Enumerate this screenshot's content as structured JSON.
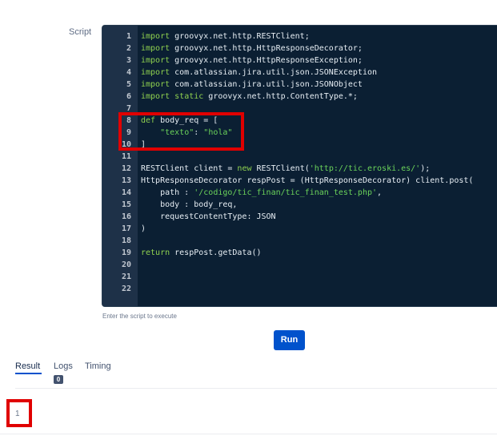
{
  "script": {
    "label": "Script",
    "hint": "Enter the script to execute",
    "lines": [
      {
        "n": "1",
        "segs": [
          {
            "t": "import",
            "k": "kw"
          },
          {
            "t": " groovyx.net.http.RESTClient;"
          }
        ]
      },
      {
        "n": "2",
        "segs": [
          {
            "t": "import",
            "k": "kw"
          },
          {
            "t": " groovyx.net.http.HttpResponseDecorator;"
          }
        ]
      },
      {
        "n": "3",
        "segs": [
          {
            "t": "import",
            "k": "kw"
          },
          {
            "t": " groovyx.net.http.HttpResponseException;"
          }
        ]
      },
      {
        "n": "4",
        "segs": [
          {
            "t": "import",
            "k": "kw"
          },
          {
            "t": " com.atlassian.jira.util.json.JSONException"
          }
        ]
      },
      {
        "n": "5",
        "segs": [
          {
            "t": "import",
            "k": "kw"
          },
          {
            "t": " com.atlassian.jira.util.json.JSONObject"
          }
        ]
      },
      {
        "n": "6",
        "segs": [
          {
            "t": "import",
            "k": "kw"
          },
          {
            "t": " "
          },
          {
            "t": "static",
            "k": "kw"
          },
          {
            "t": " groovyx.net.http.ContentType.*;"
          }
        ]
      },
      {
        "n": "7",
        "segs": []
      },
      {
        "n": "8",
        "segs": [
          {
            "t": "def",
            "k": "kw"
          },
          {
            "t": " body_req = ["
          }
        ]
      },
      {
        "n": "9",
        "segs": [
          {
            "t": "    "
          },
          {
            "t": "\"texto\"",
            "k": "str"
          },
          {
            "t": ": "
          },
          {
            "t": "\"hola\"",
            "k": "str"
          }
        ]
      },
      {
        "n": "10",
        "segs": [
          {
            "t": "]"
          }
        ]
      },
      {
        "n": "11",
        "segs": []
      },
      {
        "n": "12",
        "segs": [
          {
            "t": "RESTClient client = "
          },
          {
            "t": "new",
            "k": "kw"
          },
          {
            "t": " RESTClient("
          },
          {
            "t": "'http://tic.eroski.es/'",
            "k": "str"
          },
          {
            "t": ");"
          }
        ]
      },
      {
        "n": "13",
        "segs": [
          {
            "t": "HttpResponseDecorator respPost = (HttpResponseDecorator) client.post("
          }
        ]
      },
      {
        "n": "14",
        "segs": [
          {
            "t": "    path : "
          },
          {
            "t": "'/codigo/tic_finan/tic_finan_test.php'",
            "k": "str"
          },
          {
            "t": ","
          }
        ]
      },
      {
        "n": "15",
        "segs": [
          {
            "t": "    body : body_req,"
          }
        ]
      },
      {
        "n": "16",
        "segs": [
          {
            "t": "    requestContentType: JSON"
          }
        ]
      },
      {
        "n": "17",
        "segs": [
          {
            "t": ")"
          }
        ]
      },
      {
        "n": "18",
        "segs": []
      },
      {
        "n": "19",
        "segs": [
          {
            "t": "return",
            "k": "kw"
          },
          {
            "t": " respPost.getData()"
          }
        ]
      },
      {
        "n": "20",
        "segs": []
      },
      {
        "n": "21",
        "segs": []
      },
      {
        "n": "22",
        "segs": []
      }
    ]
  },
  "run_label": "Run",
  "tabs": [
    {
      "label": "Result",
      "active": true
    },
    {
      "label": "Logs",
      "active": false,
      "badge": "0"
    },
    {
      "label": "Timing",
      "active": false
    }
  ],
  "result_value": "1",
  "colors": {
    "accent": "#0052cc",
    "highlight_box": "#e00000",
    "editor_bg": "#0b1f33"
  }
}
